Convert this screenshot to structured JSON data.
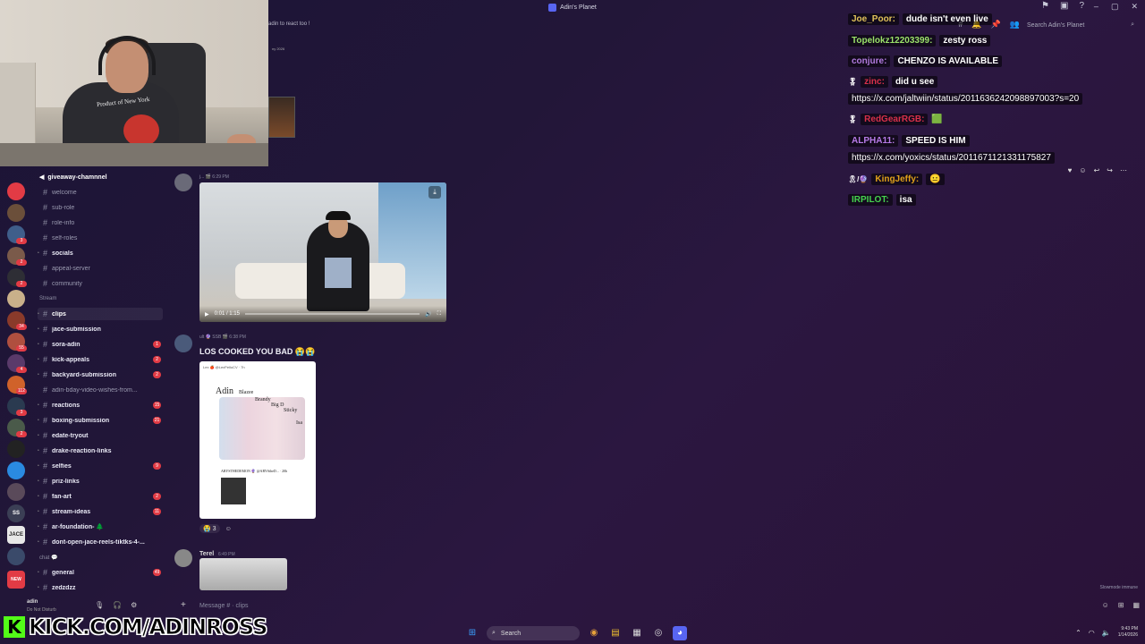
{
  "window": {
    "title": "Adin's Planet"
  },
  "top_hint": "adin to react too !",
  "mini_date": "ny 2026",
  "search": {
    "placeholder": "Search Adin's Planet"
  },
  "channels": {
    "header": "giveaway-chamnnel",
    "items": [
      {
        "label": "welcome",
        "bold": false,
        "badge": ""
      },
      {
        "label": "sub-role",
        "bold": false,
        "badge": ""
      },
      {
        "label": "role-info",
        "bold": false,
        "badge": ""
      },
      {
        "label": "self-roles",
        "bold": false,
        "badge": ""
      },
      {
        "label": "socials",
        "bold": true,
        "badge": ""
      },
      {
        "label": "appeal-server",
        "bold": false,
        "badge": ""
      },
      {
        "label": "community",
        "bold": false,
        "badge": ""
      }
    ],
    "category_stream": "Stream",
    "stream_items": [
      {
        "label": "clips",
        "bold": true,
        "badge": "",
        "active": true
      },
      {
        "label": "jace-submission",
        "bold": true,
        "badge": ""
      },
      {
        "label": "sora-adin",
        "bold": true,
        "badge": "1"
      },
      {
        "label": "kick-appeals",
        "bold": true,
        "badge": "2"
      },
      {
        "label": "backyard-submission",
        "bold": true,
        "badge": "2"
      },
      {
        "label": "adin-bday-video-wishes-from...",
        "bold": false,
        "badge": ""
      },
      {
        "label": "reactions",
        "bold": true,
        "badge": "15"
      },
      {
        "label": "boxing-submission",
        "bold": true,
        "badge": "21"
      },
      {
        "label": "edate-tryout",
        "bold": true,
        "badge": ""
      },
      {
        "label": "drake-reaction-links",
        "bold": true,
        "badge": ""
      },
      {
        "label": "selfies",
        "bold": true,
        "badge": "9"
      },
      {
        "label": "priz-links",
        "bold": true,
        "badge": ""
      },
      {
        "label": "fan-art",
        "bold": true,
        "badge": "2"
      },
      {
        "label": "stream-ideas",
        "bold": true,
        "badge": "11"
      },
      {
        "label": "ar-foundation- 🌲",
        "bold": true,
        "badge": ""
      },
      {
        "label": "dont-open-jace-reels-tiktks-4-...",
        "bold": true,
        "badge": ""
      }
    ],
    "category_chat": "chat 💬",
    "chat_items": [
      {
        "label": "general",
        "bold": true,
        "badge": "49"
      },
      {
        "label": "zedzdzz",
        "bold": true,
        "badge": ""
      }
    ]
  },
  "servers": {
    "badges": [
      "3",
      "2",
      "2",
      "34",
      "55",
      "4",
      "112",
      "3",
      "2"
    ],
    "labels": [
      "SS",
      "JACE",
      "NEW"
    ]
  },
  "user": {
    "name": "adin",
    "status": "Do Not Disturb"
  },
  "kick": {
    "logo": "K",
    "text": "KICK.COM/ADINROSS"
  },
  "messages": {
    "m1": {
      "meta": "j... 🎬 6:29 PM",
      "video_time": "0:01 / 1:15"
    },
    "m2": {
      "meta": "ult 🔮 SSB 🎬 6:38 PM",
      "text": "LOS COOKED YOU BAD 😭😭",
      "meme_title": "Adin",
      "meme_labels": [
        "Blazee",
        "Brandy",
        "Big D",
        "Sticky",
        "Isa"
      ],
      "meme_header": "Lex 🍎 @LexPelloCV · 7h",
      "meme_reply": "ARYSTHEDEMON 🔮 @ARYStheD... · 20h",
      "reaction_count": "3"
    },
    "m3": {
      "author": "Terel",
      "meta": "6:49 PM"
    }
  },
  "composer": {
    "placeholder": "Message # · clips"
  },
  "slowmode": "Slowmode immune",
  "chat_overlay": [
    {
      "user": "Joe_Poor:",
      "text": "dude isn't even live",
      "color": "#e1c25a"
    },
    {
      "user": "Topelokz12203399:",
      "text": "zesty ross",
      "color": "#9be36a"
    },
    {
      "user": "conjure:",
      "text": "CHENZO IS AVAILABLE",
      "color": "#b27be0"
    },
    {
      "user": "zinc:",
      "text": "did u see",
      "color": "#d8304a",
      "badge": "🎖"
    },
    {
      "user": "",
      "text": "https://x.com/jaltwiin/status/2011636242098897003?s=20",
      "color": "#ffffff",
      "link": true
    },
    {
      "user": "RedGearRGB:",
      "text": "",
      "color": "#d8304a",
      "badge": "🎖",
      "emote": "🟩"
    },
    {
      "user": "ALPHA11:",
      "text": "SPEED IS HIM",
      "color": "#b77be8"
    },
    {
      "user": "",
      "text": "https://x.com/yoxics/status/2011671121331175827",
      "color": "#ffffff",
      "link": true
    },
    {
      "user": "KingJeffy:",
      "text": "😐",
      "color": "#e0a11a",
      "badge": "🎗/🔮"
    },
    {
      "user": "IRPILOT:",
      "text": "isa",
      "color": "#45d34e"
    }
  ],
  "taskbar": {
    "search": "Search",
    "time": "9:43 PM",
    "date": "1/14/2026"
  }
}
